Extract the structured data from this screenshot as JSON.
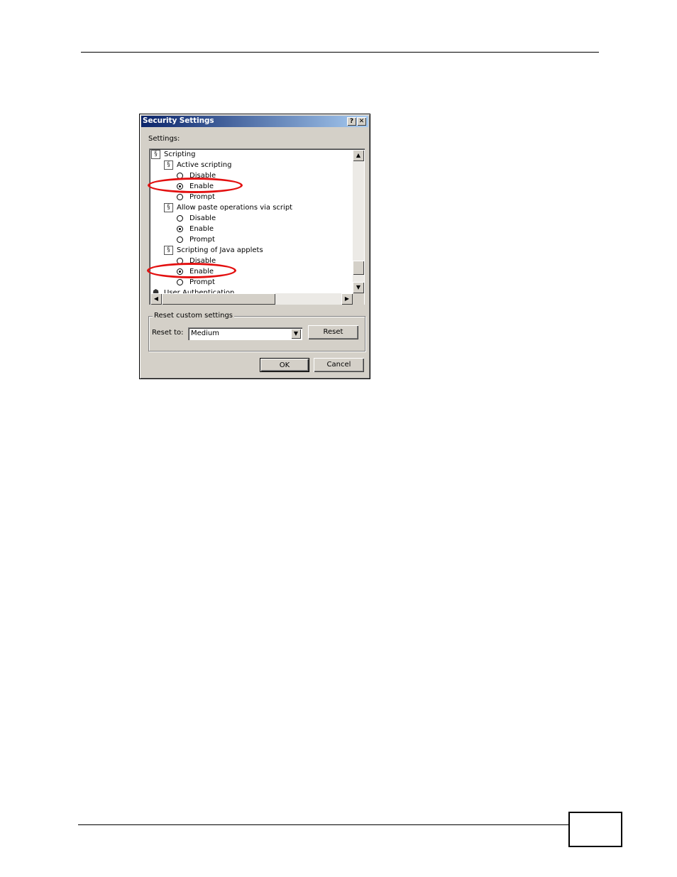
{
  "dialog": {
    "title": "Security Settings",
    "help_button": "?",
    "close_button": "✕",
    "settings_label": "Settings:",
    "tree": {
      "scripting": "Scripting",
      "active_scripting": "Active scripting",
      "active_scripting_options": [
        "Disable",
        "Enable",
        "Prompt"
      ],
      "paste_operations": "Allow paste operations via script",
      "paste_options": [
        "Disable",
        "Enable",
        "Prompt"
      ],
      "java_applets": "Scripting of Java applets",
      "java_options": [
        "Disable",
        "Enable",
        "Prompt"
      ],
      "user_authentication": "User Authentication"
    },
    "selected": {
      "active_scripting": "Enable",
      "paste_operations": "Enable",
      "java_applets": "Enable"
    },
    "reset_group_label": "Reset custom settings",
    "reset_to_label": "Reset to:",
    "reset_to_value": "Medium",
    "reset_button": "Reset",
    "ok_button": "OK",
    "cancel_button": "Cancel"
  },
  "icons": {
    "tree_setting_icon": "script-settings-icon",
    "user_auth_icon": "users-icon"
  },
  "colors": {
    "title_gradient_start": "#0a246a",
    "title_gradient_end": "#a6caf0",
    "dialog_face": "#d4d0c8",
    "highlight": "#e31010"
  }
}
